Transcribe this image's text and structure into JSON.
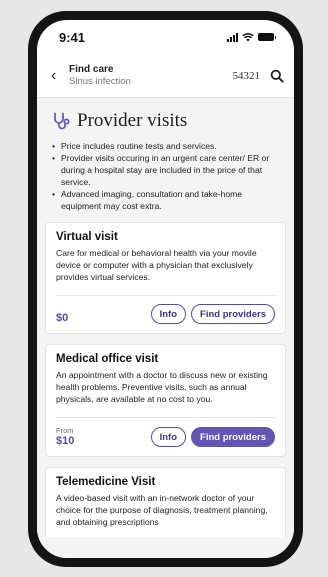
{
  "status_bar": {
    "time": "9:41"
  },
  "search": {
    "back_icon": "chevron-left-icon",
    "title": "Find care",
    "subtitle": "Sinus infection",
    "zip": "54321",
    "search_icon": "search-icon"
  },
  "header": {
    "icon": "stethoscope-icon",
    "title": "Provider visits",
    "bullets": [
      "Price includes routine tests and services.",
      "Provider visits occuring in an urgent care center/ ER or during a hospital stay are included in the price of that service.",
      "Advanced imaging, consultation and take-home equipment may cost extra."
    ]
  },
  "cards": [
    {
      "title": "Virtual visit",
      "description": "Care for medical or behavioral health via your movile device or computer with a physician that exclusively provides virtual services.",
      "price_prefix": "",
      "price": "$0",
      "info_label": "Info",
      "find_label": "Find providers"
    },
    {
      "title": "Medical office visit",
      "description": "An appointment with a doctor to discuss new or existing health problems. Preventive visits, such as annual physicals, are available at no cost to you.",
      "price_prefix": "From",
      "price": "$10",
      "info_label": "Info",
      "find_label": "Find providers"
    },
    {
      "title": "Telemedicine Visit",
      "description": "A video-based visit with an in-network doctor of your choice for the purpose of diagnosis, treatment planning, and obtaining prescriptions"
    }
  ],
  "colors": {
    "accent": "#6654b4",
    "price": "#5a4aa8",
    "background": "#f4f4f4"
  }
}
